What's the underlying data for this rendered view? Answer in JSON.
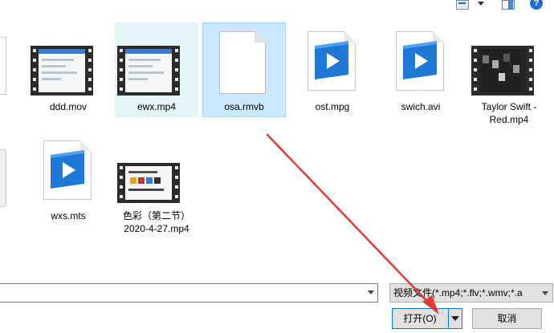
{
  "toolbar": {
    "view_icon": "view-options-icon",
    "pane_icon": "preview-pane-icon",
    "help_label": "?"
  },
  "files": [
    {
      "name": "ddd.mov",
      "type": "video-thumbnail"
    },
    {
      "name": "ewx.mp4",
      "type": "video-thumbnail"
    },
    {
      "name": "osa.rmvb",
      "type": "blank-document"
    },
    {
      "name": "ost.mpg",
      "type": "video-file"
    },
    {
      "name": "swich.avi",
      "type": "video-file"
    },
    {
      "name": "Taylor Swift - Red.mp4",
      "type": "video-thumbnail"
    },
    {
      "name": "wxs.mts",
      "type": "video-file"
    },
    {
      "name": "色彩（第二节）2020-4-27.mp4",
      "type": "video-thumbnail"
    }
  ],
  "bottom": {
    "filename_value": "",
    "filetype_value": "视频文件(*.mp4;*.flv;*.wmv;*.a",
    "open_label": "打开(O)",
    "cancel_label": "取消"
  },
  "colors": {
    "selected_bg": "#cce8ff",
    "hover_bg": "#e5f3fb",
    "accent": "#0078d7",
    "annotation_arrow": "#e53935"
  }
}
